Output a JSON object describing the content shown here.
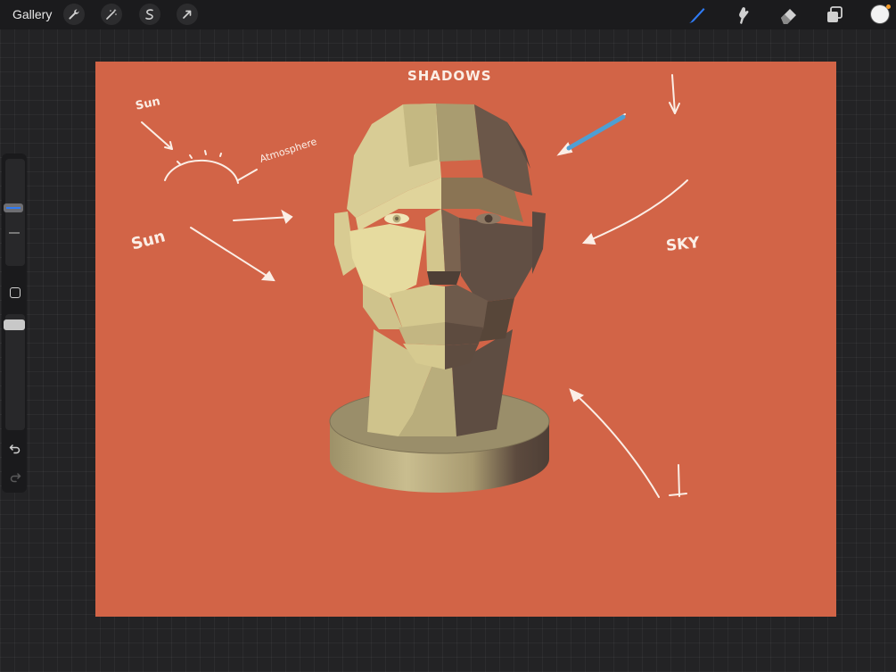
{
  "toolbar": {
    "gallery_label": "Gallery",
    "left_tools": [
      "wrench-icon",
      "magic-wand-icon",
      "selection-icon",
      "transform-arrow-icon"
    ],
    "right_tools": [
      "brush-icon",
      "smudge-icon",
      "eraser-icon",
      "layers-icon",
      "color-picker-icon"
    ],
    "active_tool": "brush",
    "accent_color": "#2f7bf5",
    "current_color": "#f2f2f2"
  },
  "sidebar": {
    "brush_size_slider": {
      "icon": "size-slider"
    },
    "opacity_slider": {
      "icon": "opacity-slider"
    },
    "modify_button_icon": "square-icon",
    "undo_icon": "undo-arrow-icon",
    "redo_icon": "redo-arrow-icon"
  },
  "canvas": {
    "background_color": "#d26447",
    "annotations": {
      "title": "SHADOWS",
      "sun_top": "Sun",
      "atmosphere": "Atmosphere",
      "sun_left": "Sun",
      "sky": "SKY"
    },
    "subject": "low-poly-head-on-pedestal"
  }
}
